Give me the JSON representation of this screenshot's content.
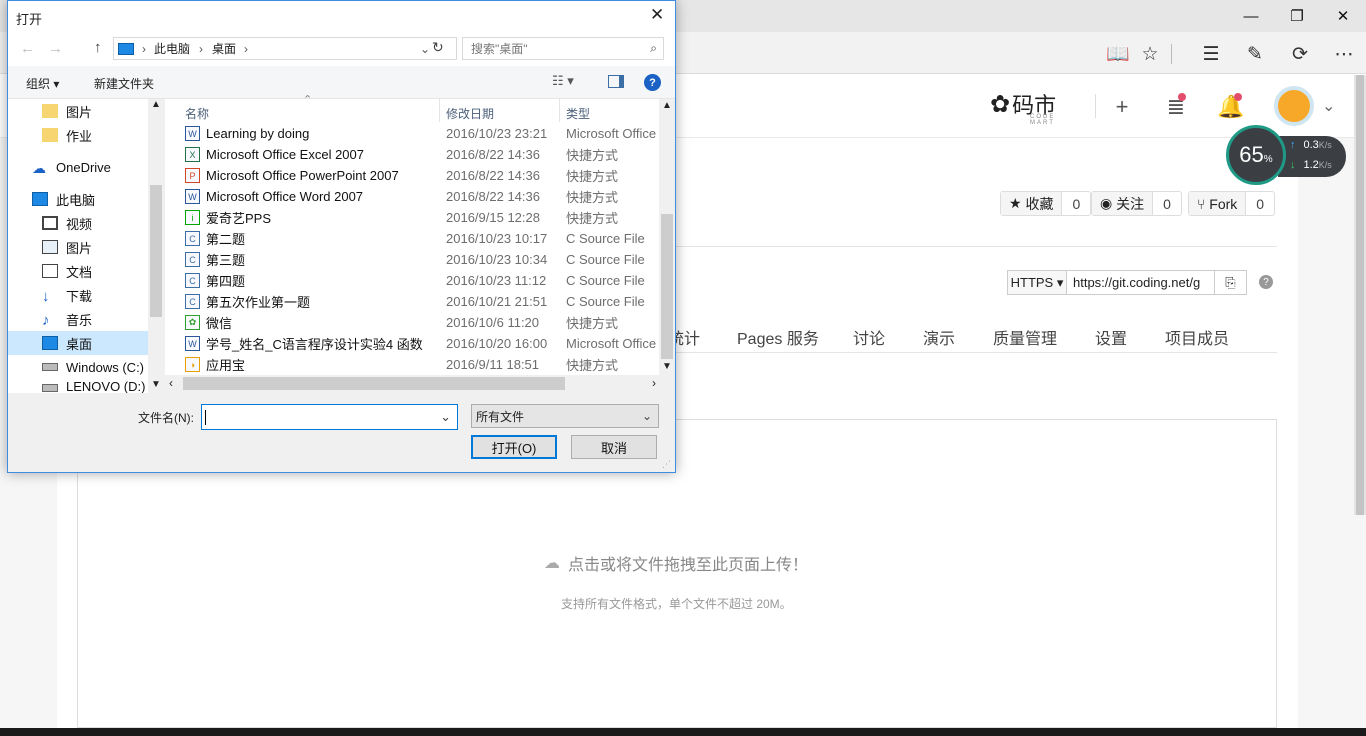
{
  "browser": {
    "window_controls": {
      "minimize": "—",
      "restore": "❐",
      "close": "✕"
    },
    "toolbar_icons": [
      "reading-view-icon",
      "favorite-icon",
      "hub-icon",
      "web-note-icon",
      "share-icon",
      "more-icon"
    ]
  },
  "site": {
    "logo_text": "码市",
    "logo_sub": "CODE MART",
    "actions": {
      "star_label": "收藏",
      "star_count": "0",
      "watch_label": "关注",
      "watch_count": "0",
      "fork_label": "Fork",
      "fork_count": "0"
    },
    "clone": {
      "protocol": "HTTPS",
      "url": "https://git.coding.net/g",
      "help": "?"
    },
    "tabs": [
      "统计",
      "Pages 服务",
      "讨论",
      "演示",
      "质量管理",
      "设置",
      "项目成员"
    ],
    "upload": {
      "title": "点击或将文件拖拽至此页面上传！",
      "subtitle": "支持所有文件格式，单个文件不超过 20M。"
    }
  },
  "net_widget": {
    "percent": "65",
    "percent_unit": "%",
    "up": "0.3",
    "up_unit": "K/s",
    "down": "1.2",
    "down_unit": "K/s"
  },
  "dialog": {
    "title": "打开",
    "close": "✕",
    "breadcrumb": [
      "此电脑",
      "桌面"
    ],
    "search_placeholder": "搜索\"桌面\"",
    "organize": "组织",
    "new_folder": "新建文件夹",
    "help": "?",
    "nav_items": [
      {
        "label": "图片",
        "icon": "folder-icon"
      },
      {
        "label": "作业",
        "icon": "folder-icon"
      },
      {
        "label": "OneDrive",
        "icon": "cloud-icon"
      },
      {
        "label": "此电脑",
        "icon": "computer-icon"
      },
      {
        "label": "视频",
        "icon": "video-icon"
      },
      {
        "label": "图片",
        "icon": "pictures-icon"
      },
      {
        "label": "文档",
        "icon": "documents-icon"
      },
      {
        "label": "下载",
        "icon": "download-icon"
      },
      {
        "label": "音乐",
        "icon": "music-icon"
      },
      {
        "label": "桌面",
        "icon": "desktop-icon"
      },
      {
        "label": "Windows (C:)",
        "icon": "drive-icon"
      },
      {
        "label": "LENOVO (D:)",
        "icon": "drive-icon"
      }
    ],
    "columns": {
      "name": "名称",
      "date": "修改日期",
      "type": "类型"
    },
    "files": [
      {
        "name": "Learning by doing",
        "date": "2016/10/23 23:21",
        "type": "Microsoft Office",
        "icon": "word-doc-icon",
        "glyph": "W",
        "color": "#2b579a"
      },
      {
        "name": "Microsoft Office Excel 2007",
        "date": "2016/8/22 14:36",
        "type": "快捷方式",
        "icon": "excel-icon",
        "glyph": "X",
        "color": "#217346"
      },
      {
        "name": "Microsoft Office PowerPoint 2007",
        "date": "2016/8/22 14:36",
        "type": "快捷方式",
        "icon": "powerpoint-icon",
        "glyph": "P",
        "color": "#d24726"
      },
      {
        "name": "Microsoft Office Word 2007",
        "date": "2016/8/22 14:36",
        "type": "快捷方式",
        "icon": "word-icon",
        "glyph": "W",
        "color": "#2b579a"
      },
      {
        "name": "爱奇艺PPS",
        "date": "2016/9/15 12:28",
        "type": "快捷方式",
        "icon": "iqiyi-icon",
        "glyph": "i",
        "color": "#00a800"
      },
      {
        "name": "第二题",
        "date": "2016/10/23 10:17",
        "type": "C Source File",
        "icon": "c-source-icon",
        "glyph": "C",
        "color": "#3a6ea5"
      },
      {
        "name": "第三题",
        "date": "2016/10/23 10:34",
        "type": "C Source File",
        "icon": "c-source-icon",
        "glyph": "C",
        "color": "#3a6ea5"
      },
      {
        "name": "第四题",
        "date": "2016/10/23 11:12",
        "type": "C Source File",
        "icon": "c-source-icon",
        "glyph": "C",
        "color": "#3a6ea5"
      },
      {
        "name": "第五次作业第一题",
        "date": "2016/10/21 21:51",
        "type": "C Source File",
        "icon": "c-source-icon",
        "glyph": "C",
        "color": "#3a6ea5"
      },
      {
        "name": "微信",
        "date": "2016/10/6 11:20",
        "type": "快捷方式",
        "icon": "wechat-icon",
        "glyph": "✿",
        "color": "#2ea02e"
      },
      {
        "name": "学号_姓名_C语言程序设计实验4 函数",
        "date": "2016/10/20 16:00",
        "type": "Microsoft Office",
        "icon": "word-doc-icon",
        "glyph": "W",
        "color": "#2b579a"
      },
      {
        "name": "应用宝",
        "date": "2016/9/11 18:51",
        "type": "快捷方式",
        "icon": "yingyongbao-icon",
        "glyph": "◑",
        "color": "#e8a000"
      }
    ],
    "filename_label": "文件名(N):",
    "filename_value": "",
    "filetype": "所有文件",
    "open_button": "打开(O)",
    "cancel_button": "取消"
  }
}
